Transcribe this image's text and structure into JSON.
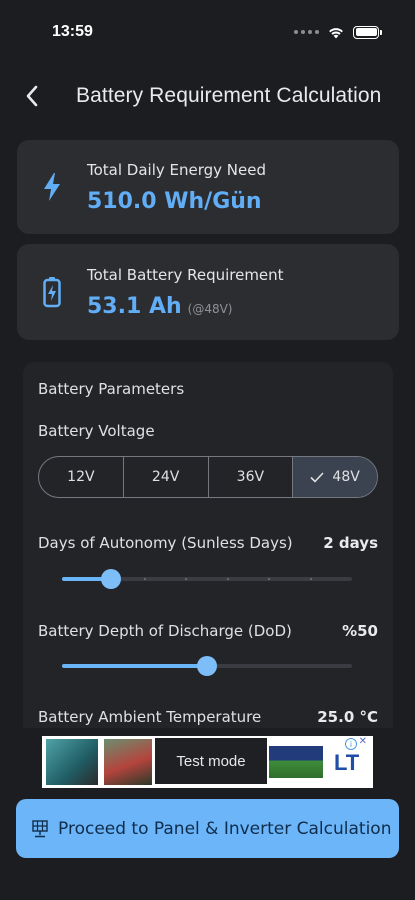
{
  "status_bar": {
    "time": "13:59"
  },
  "nav": {
    "title": "Battery Requirement Calculation"
  },
  "daily_energy": {
    "label": "Total Daily Energy Need",
    "value": "510.0 Wh/Gün"
  },
  "battery_req": {
    "label": "Total Battery Requirement",
    "value": "53.1 Ah",
    "suffix": "(@48V)"
  },
  "params": {
    "title": "Battery Parameters",
    "voltage_label": "Battery Voltage",
    "voltage_options": [
      "12V",
      "24V",
      "36V",
      "48V"
    ],
    "voltage_selected": "48V",
    "autonomy_label": "Days of Autonomy (Sunless Days)",
    "autonomy_value": "2 days",
    "autonomy_fraction": 0.17,
    "dod_label": "Battery Depth of Discharge (DoD)",
    "dod_value": "%50",
    "dod_fraction": 0.5,
    "temp_label": "Battery Ambient Temperature",
    "temp_value": "25.0 °C"
  },
  "ad": {
    "badge": "Test mode",
    "logo": "LT"
  },
  "proceed_button": {
    "label": "Proceed to Panel & Inverter Calculation"
  },
  "colors": {
    "accent": "#6bb5f8",
    "card": "#2b2d31",
    "background": "#1c1d20"
  }
}
